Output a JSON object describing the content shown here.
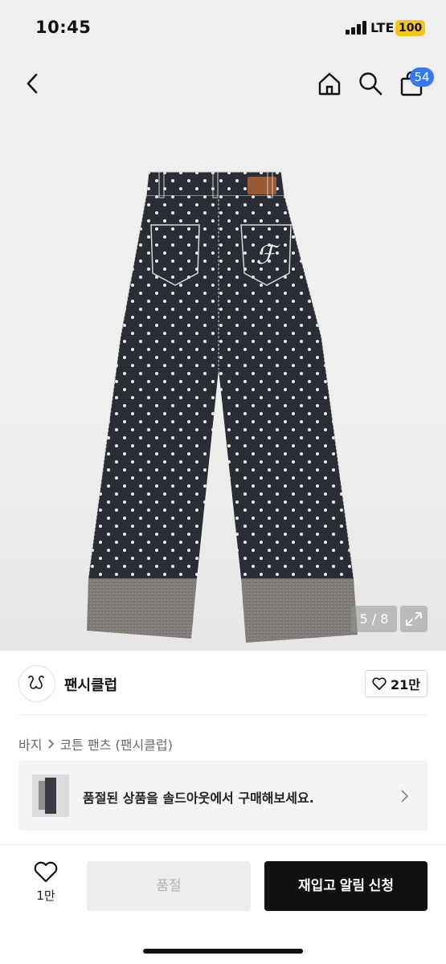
{
  "status_bar": {
    "time": "10:45",
    "network": "LTE",
    "battery": "100"
  },
  "nav": {
    "cart_count": "54",
    "icons": [
      "back-icon",
      "home-icon",
      "search-icon",
      "cart-icon"
    ]
  },
  "gallery": {
    "counter": "5 / 8"
  },
  "brand": {
    "name": "팬시클럽",
    "like_count": "21만"
  },
  "breadcrumb": {
    "category": "바지",
    "subcategory": "코튼 팬츠 (팬시클럽)"
  },
  "soldout_banner": {
    "text": "품절된 상품을 솔드아웃에서 구매해보세요."
  },
  "bottom_bar": {
    "wish_count": "1만",
    "soldout_label": "품절",
    "restock_label": "재입고 알림 신청"
  },
  "colors": {
    "accent_badge": "#3478f6",
    "battery": "#f5c518",
    "primary_button": "#111111",
    "disabled_button": "#ececec"
  }
}
